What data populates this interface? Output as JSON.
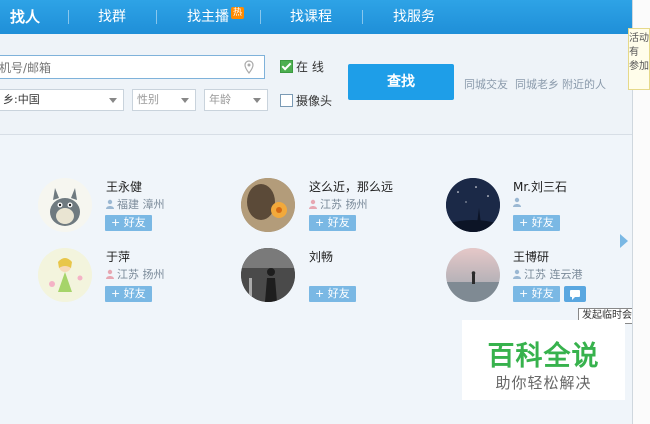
{
  "tabs": [
    {
      "label": "找人"
    },
    {
      "label": "找群"
    },
    {
      "label": "找主播",
      "badge": "热"
    },
    {
      "label": "找课程"
    },
    {
      "label": "找服务"
    }
  ],
  "search": {
    "placeholder": "机号/邮箱",
    "online_label": "在 线",
    "camera_label": "摄像头",
    "hometown_value": "乡:中国",
    "gender_placeholder": "性别",
    "age_placeholder": "年龄",
    "find_button": "查找",
    "quick_links": [
      "同城交友",
      "同城老乡",
      "附近的人"
    ]
  },
  "people": [
    {
      "name": "王永健",
      "location": "福建 漳州",
      "add": "+ 好友"
    },
    {
      "name": "这么近，那么远",
      "location": "江苏 扬州",
      "add": "+ 好友"
    },
    {
      "name": "Mr.刘三石",
      "location": "",
      "add": "+ 好友"
    },
    {
      "name": "于萍",
      "location": "江苏 扬州",
      "add": "+ 好友"
    },
    {
      "name": "刘畅",
      "location": "",
      "add": "+ 好友"
    },
    {
      "name": "王博研",
      "location": "江苏 连云港",
      "add": "+ 好友"
    }
  ],
  "tooltip": "发起临时会话",
  "side_ad": [
    "活动",
    "有",
    "参加"
  ],
  "watermark": {
    "title": "百科全说",
    "subtitle": "助你轻松解决"
  },
  "colors": {
    "accent": "#1e9ee8",
    "add_button": "#7ab8e4",
    "watermark_green": "#37b24d"
  }
}
